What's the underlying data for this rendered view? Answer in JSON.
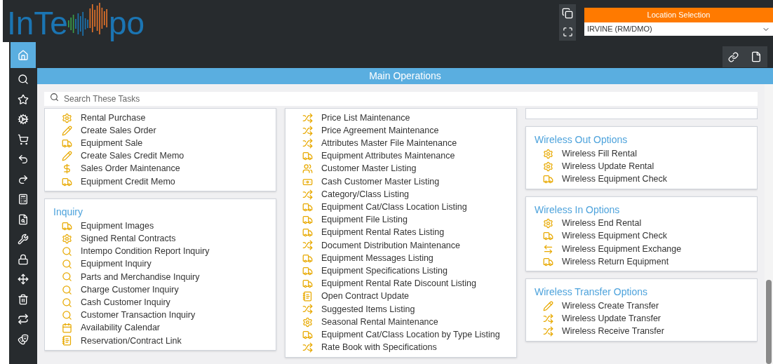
{
  "logo": {
    "left": "InTe",
    "right": "po"
  },
  "location": {
    "title": "Location Selection",
    "value": "IRVINE (RM/DMO)"
  },
  "sidebar": {
    "items": [
      {
        "kind": "home",
        "selected": true
      },
      {
        "kind": "search",
        "selected": false
      },
      {
        "kind": "star",
        "selected": false
      },
      {
        "kind": "gears",
        "selected": false
      },
      {
        "kind": "cart",
        "selected": false
      },
      {
        "kind": "return",
        "selected": false
      },
      {
        "kind": "send",
        "selected": false
      },
      {
        "kind": "calculator",
        "selected": false
      },
      {
        "kind": "docsearch",
        "selected": false
      },
      {
        "kind": "wrench",
        "selected": false
      },
      {
        "kind": "lock",
        "selected": false
      },
      {
        "kind": "move",
        "selected": false
      },
      {
        "kind": "trash",
        "selected": false
      },
      {
        "kind": "repeat",
        "selected": false
      },
      {
        "kind": "masks",
        "selected": false
      }
    ]
  },
  "main": {
    "title": "Main Operations",
    "search": {
      "placeholder": "Search These Tasks"
    }
  },
  "columns": [
    [
      {
        "items": [
          {
            "kind": "gear",
            "label": "Rental Purchase"
          },
          {
            "kind": "pencil",
            "label": "Create Sales Order"
          },
          {
            "kind": "truck",
            "label": "Equipment Sale"
          },
          {
            "kind": "pencil",
            "label": "Create Sales Credit Memo"
          },
          {
            "kind": "dollar",
            "label": "Sales Order Maintenance"
          },
          {
            "kind": "truck",
            "label": "Equipment Credit Memo"
          }
        ]
      },
      {
        "title": "Inquiry",
        "items": [
          {
            "kind": "truck",
            "label": "Equipment Images"
          },
          {
            "kind": "gear",
            "label": "Signed Rental Contracts"
          },
          {
            "kind": "search",
            "label": "Intempo Condition Report Inquiry"
          },
          {
            "kind": "search",
            "label": "Equipment Inquiry"
          },
          {
            "kind": "search",
            "label": "Parts and Merchandise Inquiry"
          },
          {
            "kind": "search",
            "label": "Charge Customer Inquiry"
          },
          {
            "kind": "search",
            "label": "Cash Customer Inquiry"
          },
          {
            "kind": "search",
            "label": "Customer Transaction Inquiry"
          },
          {
            "kind": "calendar",
            "label": "Availability Calendar"
          },
          {
            "kind": "book",
            "label": "Reservation/Contract Link"
          }
        ]
      }
    ],
    [
      {
        "items": [
          {
            "kind": "shuffle",
            "label": "Price List Maintenance"
          },
          {
            "kind": "shuffle",
            "label": "Price Agreement Maintenance"
          },
          {
            "kind": "shuffle",
            "label": "Attributes Master File Maintenance"
          },
          {
            "kind": "truck",
            "label": "Equipment Attributes Maintenance"
          },
          {
            "kind": "users",
            "label": "Customer Master Listing"
          },
          {
            "kind": "cash",
            "label": "Cash Customer Master Listing"
          },
          {
            "kind": "shuffle",
            "label": "Category/Class Listing"
          },
          {
            "kind": "truck",
            "label": "Equipment Cat/Class Location Listing"
          },
          {
            "kind": "truck",
            "label": "Equipment File Listing"
          },
          {
            "kind": "truck",
            "label": "Equipment Rental Rates Listing"
          },
          {
            "kind": "shuffle",
            "label": "Document Distribution Maintenance"
          },
          {
            "kind": "truck",
            "label": "Equipment Messages Listing"
          },
          {
            "kind": "truck",
            "label": "Equipment Specifications Listing"
          },
          {
            "kind": "truck",
            "label": "Equipment Rental Rate Discount Listing"
          },
          {
            "kind": "book",
            "label": "Open Contract Update"
          },
          {
            "kind": "shuffle",
            "label": "Suggested Items Listing"
          },
          {
            "kind": "gear",
            "label": "Seasonal Rental Maintenance"
          },
          {
            "kind": "truck",
            "label": "Equipment Cat/Class Location by Type Listing"
          },
          {
            "kind": "shuffle",
            "label": "Rate Book with Specifications"
          }
        ]
      }
    ],
    [
      {
        "kind": "clipped"
      },
      {
        "title": "Wireless Out Options",
        "items": [
          {
            "kind": "gear",
            "label": "Wireless Fill Rental"
          },
          {
            "kind": "gear",
            "label": "Wireless Update Rental"
          },
          {
            "kind": "truck",
            "label": "Wireless Equipment Check"
          }
        ]
      },
      {
        "title": "Wireless In Options",
        "items": [
          {
            "kind": "gear",
            "label": "Wireless End Rental"
          },
          {
            "kind": "truck",
            "label": "Wireless Equipment Check"
          },
          {
            "kind": "exchange",
            "label": "Wireless Equipment Exchange"
          },
          {
            "kind": "truck",
            "label": "Wireless Return Equipment"
          }
        ]
      },
      {
        "title": "Wireless Transfer Options",
        "items": [
          {
            "kind": "pencil",
            "label": "Wireless Create Transfer"
          },
          {
            "kind": "shuffle",
            "label": "Wireless Update Transfer"
          },
          {
            "kind": "shuffle",
            "label": "Wireless Receive Transfer"
          }
        ]
      }
    ]
  ]
}
